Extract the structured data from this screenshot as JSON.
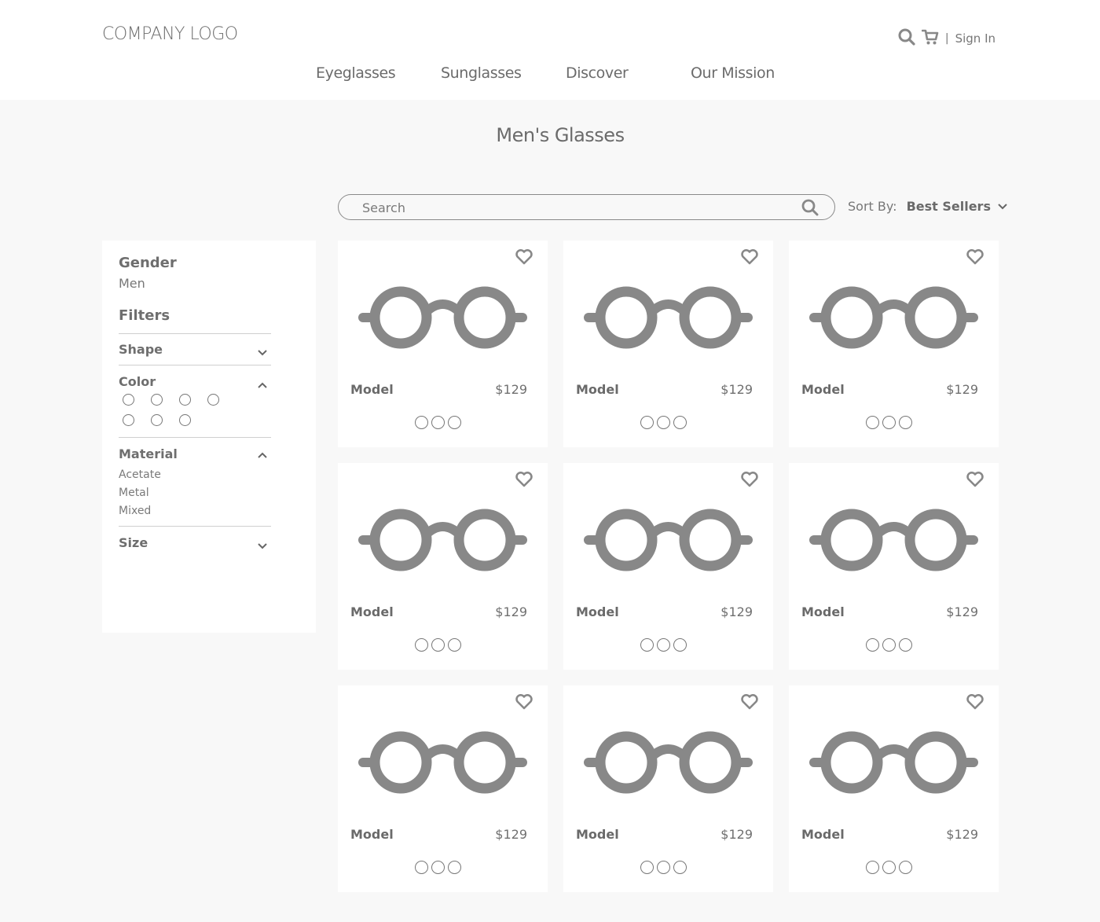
{
  "header": {
    "logo": "COMPANY LOGO",
    "utility": {
      "search_icon": "search-icon",
      "cart_icon": "cart-icon",
      "separator": "|",
      "sign_in": "Sign In"
    },
    "nav": [
      "Eyeglasses",
      "Sunglasses",
      "Discover",
      "Our Mission"
    ]
  },
  "page": {
    "title": "Men's Glasses"
  },
  "search": {
    "placeholder": "Search",
    "value": ""
  },
  "sort": {
    "label": "Sort By:",
    "value": "Best Sellers"
  },
  "sidebar": {
    "gender_heading": "Gender",
    "gender_value": "Men",
    "filters_heading": "Filters",
    "sections": {
      "shape": {
        "label": "Shape",
        "state": "collapsed"
      },
      "color": {
        "label": "Color",
        "state": "expanded",
        "swatch_count": 7
      },
      "material": {
        "label": "Material",
        "state": "expanded",
        "options": [
          "Acetate",
          "Metal",
          "Mixed"
        ]
      },
      "size": {
        "label": "Size",
        "state": "collapsed"
      }
    }
  },
  "products": [
    {
      "name": "Model",
      "price": "$129",
      "color_options": 3
    },
    {
      "name": "Model",
      "price": "$129",
      "color_options": 3
    },
    {
      "name": "Model",
      "price": "$129",
      "color_options": 3
    },
    {
      "name": "Model",
      "price": "$129",
      "color_options": 3
    },
    {
      "name": "Model",
      "price": "$129",
      "color_options": 3
    },
    {
      "name": "Model",
      "price": "$129",
      "color_options": 3
    },
    {
      "name": "Model",
      "price": "$129",
      "color_options": 3
    },
    {
      "name": "Model",
      "price": "$129",
      "color_options": 3
    },
    {
      "name": "Model",
      "price": "$129",
      "color_options": 3
    }
  ],
  "colors": {
    "icon_gray": "#888888",
    "text": "#6e6e6e",
    "background": "#f8f8f8",
    "card": "#ffffff"
  }
}
